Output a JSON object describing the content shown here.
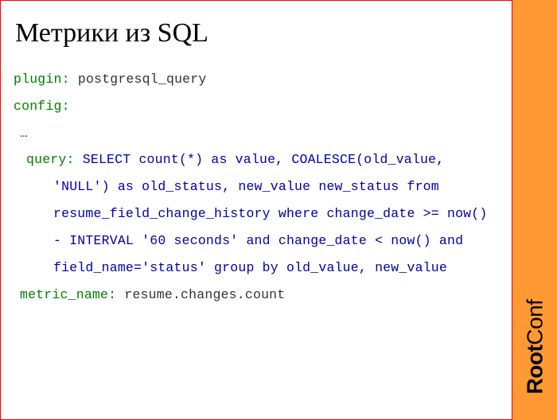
{
  "brand": {
    "bold": "Root",
    "light": "Conf"
  },
  "title": "Метрики из SQL",
  "code": {
    "plugin_key": "plugin",
    "plugin_value": "postgresql_query",
    "config_key": "config",
    "ellipsis": "…",
    "query_key": "query",
    "query_value": "SELECT count(*) as value, COALESCE(old_value, 'NULL') as old_status, new_value new_status from resume_field_change_history where change_date >= now() - INTERVAL '60 seconds' and change_date < now() and field_name='status' group by old_value, new_value",
    "metric_name_key": "metric_name",
    "metric_name_value": "resume.changes.count"
  }
}
